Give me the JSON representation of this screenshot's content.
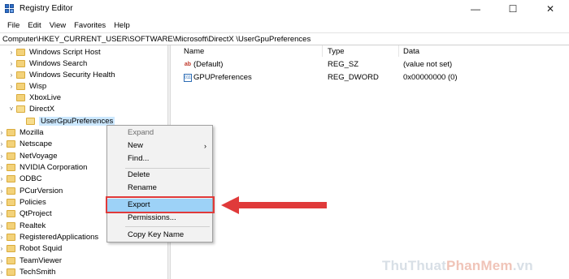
{
  "window": {
    "title": "Registry Editor",
    "controls": {
      "minimize": "—",
      "maximize": "☐",
      "close": "✕"
    }
  },
  "menu": [
    "File",
    "Edit",
    "View",
    "Favorites",
    "Help"
  ],
  "address": "Computer\\HKEY_CURRENT_USER\\SOFTWARE\\Microsoft\\DirectX \\UserGpuPreferences",
  "tree": {
    "items": [
      {
        "label": "Windows Script Host",
        "expand": "›"
      },
      {
        "label": "Windows Search",
        "expand": "›"
      },
      {
        "label": "Windows Security Health",
        "expand": "›"
      },
      {
        "label": "Wisp",
        "expand": "›"
      },
      {
        "label": "XboxLive",
        "expand": ""
      },
      {
        "label": "DirectX",
        "expand": "˅"
      },
      {
        "label": "UserGpuPreferences",
        "expand": ""
      },
      {
        "label": "Mozilla",
        "expand": "›"
      },
      {
        "label": "Netscape",
        "expand": "›"
      },
      {
        "label": "NetVoyage",
        "expand": "›"
      },
      {
        "label": "NVIDIA Corporation",
        "expand": "›"
      },
      {
        "label": "ODBC",
        "expand": "›"
      },
      {
        "label": "PCurVersion",
        "expand": "›"
      },
      {
        "label": "Policies",
        "expand": "›"
      },
      {
        "label": "QtProject",
        "expand": "›"
      },
      {
        "label": "Realtek",
        "expand": "›"
      },
      {
        "label": "RegisteredApplications",
        "expand": "›"
      },
      {
        "label": "Robot Squid",
        "expand": "›"
      },
      {
        "label": "TeamViewer",
        "expand": "›"
      },
      {
        "label": "TechSmith",
        "expand": "›"
      }
    ]
  },
  "list": {
    "columns": [
      "Name",
      "Type",
      "Data"
    ],
    "rows": [
      {
        "icon": "string-value-icon",
        "icon_text": "ab",
        "name": "(Default)",
        "type": "REG_SZ",
        "data": "(value not set)"
      },
      {
        "icon": "dword-value-icon",
        "icon_text": "011",
        "name": "GPUPreferences",
        "type": "REG_DWORD",
        "data": "0x00000000 (0)"
      }
    ]
  },
  "context_menu": {
    "items": [
      {
        "label": "Expand",
        "disabled": true
      },
      {
        "label": "New",
        "submenu": "›"
      },
      {
        "label": "Find..."
      },
      {
        "label": "Delete"
      },
      {
        "label": "Rename"
      },
      {
        "label": "Export",
        "highlighted": true
      },
      {
        "label": "Permissions..."
      },
      {
        "label": "Copy Key Name"
      }
    ]
  },
  "watermark": {
    "part1": "ThuThuat",
    "part2": "PhanMem",
    "part3": ".vn"
  },
  "colors": {
    "highlight": "#9dd2f7",
    "annotation": "#e03a3a",
    "folder": "#f3d27a"
  }
}
